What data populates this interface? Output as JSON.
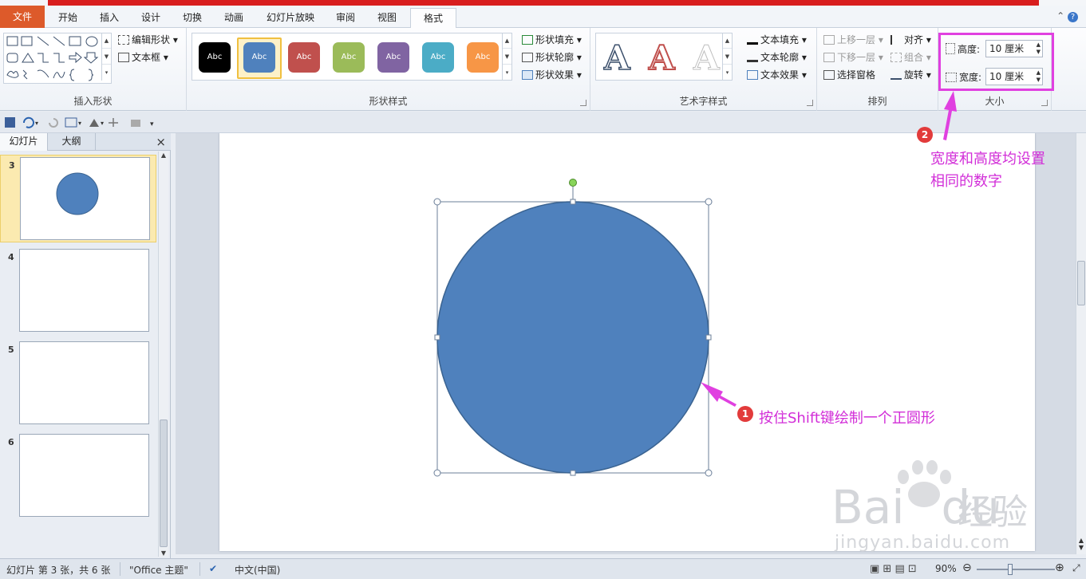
{
  "ribbon_tabs": [
    "文件",
    "开始",
    "插入",
    "设计",
    "切换",
    "动画",
    "幻灯片放映",
    "审阅",
    "视图",
    "格式"
  ],
  "groups": {
    "insert_shapes": {
      "label": "插入形状",
      "edit_shape": "编辑形状",
      "text_box": "文本框"
    },
    "shape_styles": {
      "label": "形状样式",
      "swatch_text": "Abc",
      "swatch_colors": [
        "#000000",
        "#4f81bd",
        "#c0504d",
        "#9bbb59",
        "#8064a2",
        "#4bacc6",
        "#f79646"
      ],
      "fill": "形状填充",
      "outline": "形状轮廓",
      "effects": "形状效果"
    },
    "wordart": {
      "label": "艺术字样式",
      "letter": "A",
      "text_fill": "文本填充",
      "text_outline": "文本轮廓",
      "text_effects": "文本效果"
    },
    "arrange": {
      "label": "排列",
      "bring_forward": "上移一层",
      "send_backward": "下移一层",
      "selection_pane": "选择窗格",
      "align": "对齐",
      "group": "组合",
      "rotate": "旋转"
    },
    "size": {
      "label": "大小",
      "height_label": "高度:",
      "height_value": "10 厘米",
      "width_label": "宽度:",
      "width_value": "10 厘米"
    }
  },
  "panel": {
    "tab_slides": "幻灯片",
    "tab_outline": "大纲",
    "close": "×",
    "thumbnails": [
      {
        "num": "3",
        "has_circle": true
      },
      {
        "num": "4",
        "has_circle": false
      },
      {
        "num": "5",
        "has_circle": false
      },
      {
        "num": "6",
        "has_circle": false
      }
    ]
  },
  "annotations": {
    "step1_badge": "1",
    "step1_text": "按住Shift键绘制一个正圆形",
    "step2_badge": "2",
    "step2_line1": "宽度和高度均设置",
    "step2_line2": "相同的数字"
  },
  "watermark": {
    "brand": "Bai",
    "brand2": "du",
    "cn": "经验",
    "url": "jingyan.baidu.com"
  },
  "status": {
    "slide_info": "幻灯片 第 3 张，共 6 张",
    "theme": "\"Office 主题\"",
    "language": "中文(中国)",
    "zoom": "90%"
  },
  "colors": {
    "circle_fill": "#4f81bd",
    "circle_stroke": "#3a6391",
    "annotation": "#d22ed8",
    "highlight_box": "#e040e0",
    "file_tab": "#dd5a2a"
  }
}
